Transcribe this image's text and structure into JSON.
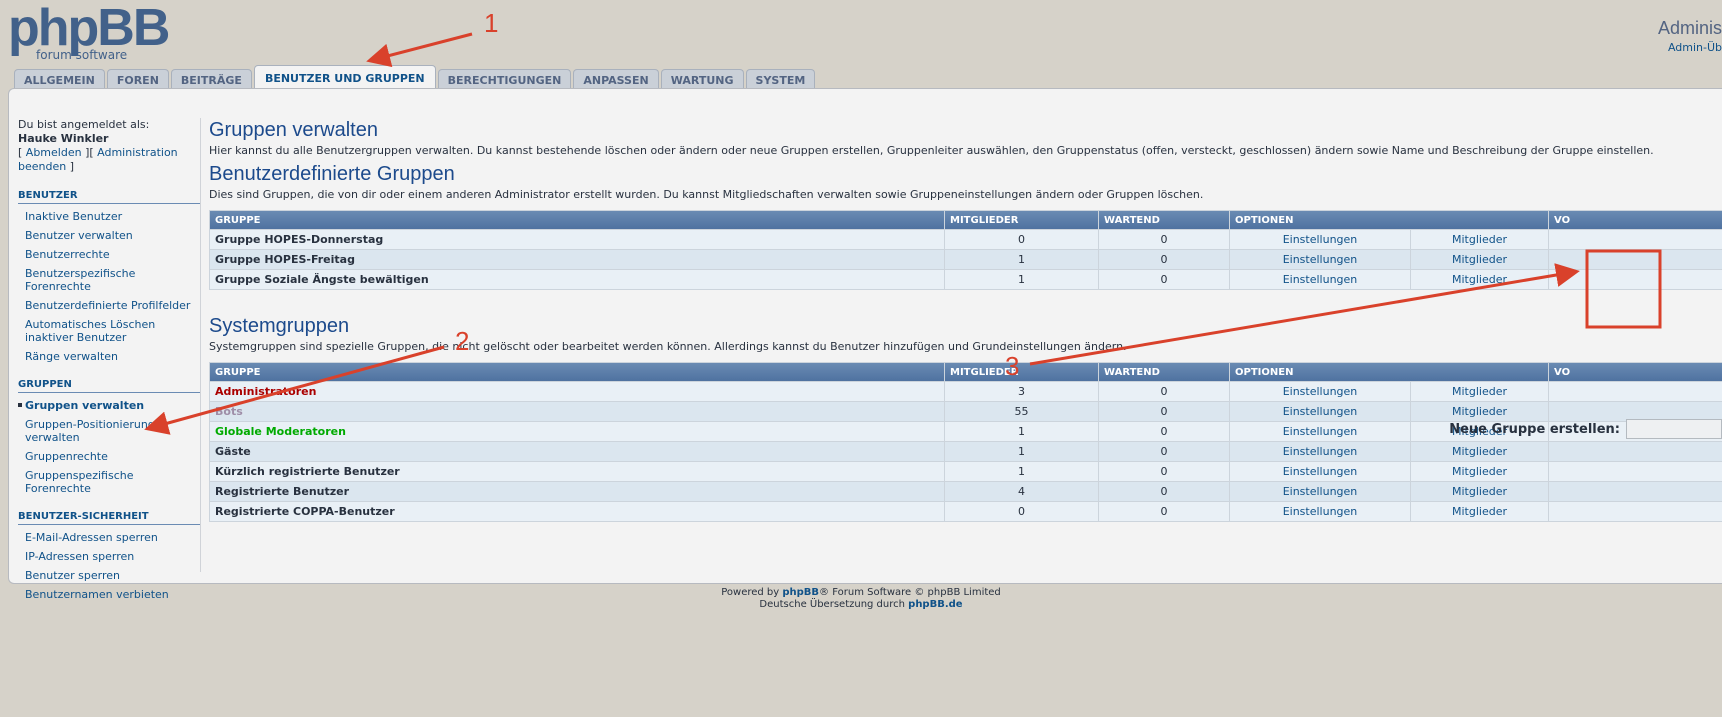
{
  "header": {
    "logo_main": "phpBB",
    "logo_sub": "forum software",
    "top_title": "Adminis",
    "top_link": "Admin-Üb"
  },
  "tabs": [
    {
      "label": "ALLGEMEIN"
    },
    {
      "label": "FOREN"
    },
    {
      "label": "BEITRÄGE"
    },
    {
      "label": "BENUTZER UND GRUPPEN",
      "active": true
    },
    {
      "label": "BERECHTIGUNGEN"
    },
    {
      "label": "ANPASSEN"
    },
    {
      "label": "WARTUNG"
    },
    {
      "label": "SYSTEM"
    }
  ],
  "sidebar": {
    "logged_in_as": "Du bist angemeldet als:",
    "username": "Hauke Winkler",
    "logout": "Abmelden",
    "admin_end": "Administration beenden",
    "sections": [
      {
        "title": "BENUTZER",
        "items": [
          "Inaktive Benutzer",
          "Benutzer verwalten",
          "Benutzerrechte",
          "Benutzerspezifische Forenrechte",
          "Benutzerdefinierte Profilfelder",
          "Automatisches Löschen inaktiver Benutzer",
          "Ränge verwalten"
        ]
      },
      {
        "title": "GRUPPEN",
        "items": [
          "Gruppen verwalten",
          "Gruppen-Positionierung verwalten",
          "Gruppenrechte",
          "Gruppenspezifische Forenrechte"
        ]
      },
      {
        "title": "BENUTZER-SICHERHEIT",
        "items": [
          "E-Mail-Adressen sperren",
          "IP-Adressen sperren",
          "Benutzer sperren",
          "Benutzernamen verbieten"
        ]
      }
    ]
  },
  "main": {
    "title": "Gruppen verwalten",
    "description": "Hier kannst du alle Benutzergruppen verwalten. Du kannst bestehende löschen oder ändern oder neue Gruppen erstellen, Gruppenleiter auswählen, den Gruppenstatus (offen, versteckt, geschlossen) ändern sowie Name und Beschreibung der Gruppe einstellen.",
    "custom_title": "Benutzerdefinierte Gruppen",
    "custom_description": "Dies sind Gruppen, die von dir oder einem anderen Administrator erstellt wurden. Du kannst Mitgliedschaften verwalten sowie Gruppeneinstellungen ändern oder Gruppen löschen.",
    "columns": [
      "GRUPPE",
      "MITGLIEDER",
      "WARTEND",
      "OPTIONEN",
      "VO"
    ],
    "custom_groups": [
      {
        "name": "Gruppe HOPES-Donnerstag",
        "members": "0",
        "pending": "0",
        "settings": "Einstellungen",
        "members_link": "Mitglieder",
        "color": "#28313f"
      },
      {
        "name": "Gruppe HOPES-Freitag",
        "members": "1",
        "pending": "0",
        "settings": "Einstellungen",
        "members_link": "Mitglieder",
        "color": "#28313f"
      },
      {
        "name": "Gruppe Soziale Ängste bewältigen",
        "members": "1",
        "pending": "0",
        "settings": "Einstellungen",
        "members_link": "Mitglieder",
        "color": "#28313f"
      }
    ],
    "new_group_label": "Neue Gruppe erstellen:",
    "system_title": "Systemgruppen",
    "system_description": "Systemgruppen sind spezielle Gruppen, die nicht gelöscht oder bearbeitet werden können. Allerdings kannst du Benutzer hinzufügen und Grundeinstellungen ändern.",
    "system_groups": [
      {
        "name": "Administratoren",
        "members": "3",
        "pending": "0",
        "settings": "Einstellungen",
        "members_link": "Mitglieder",
        "color": "#aa0000"
      },
      {
        "name": "Bots",
        "members": "55",
        "pending": "0",
        "settings": "Einstellungen",
        "members_link": "Mitglieder",
        "color": "#9e8da7"
      },
      {
        "name": "Globale Moderatoren",
        "members": "1",
        "pending": "0",
        "settings": "Einstellungen",
        "members_link": "Mitglieder",
        "color": "#00aa00"
      },
      {
        "name": "Gäste",
        "members": "1",
        "pending": "0",
        "settings": "Einstellungen",
        "members_link": "Mitglieder",
        "color": "#28313f"
      },
      {
        "name": "Kürzlich registrierte Benutzer",
        "members": "1",
        "pending": "0",
        "settings": "Einstellungen",
        "members_link": "Mitglieder",
        "color": "#28313f"
      },
      {
        "name": "Registrierte Benutzer",
        "members": "4",
        "pending": "0",
        "settings": "Einstellungen",
        "members_link": "Mitglieder",
        "color": "#28313f"
      },
      {
        "name": "Registrierte COPPA-Benutzer",
        "members": "0",
        "pending": "0",
        "settings": "Einstellungen",
        "members_link": "Mitglieder",
        "color": "#28313f"
      }
    ]
  },
  "footer": {
    "line1_a": "Powered by ",
    "line1_b": "phpBB",
    "line1_c": "® Forum Software © phpBB Limited",
    "line2_a": "Deutsche Übersetzung durch ",
    "line2_b": "phpBB.de"
  },
  "annotations": {
    "labels": [
      "1",
      "2",
      "3"
    ],
    "color": "#d9412b"
  }
}
